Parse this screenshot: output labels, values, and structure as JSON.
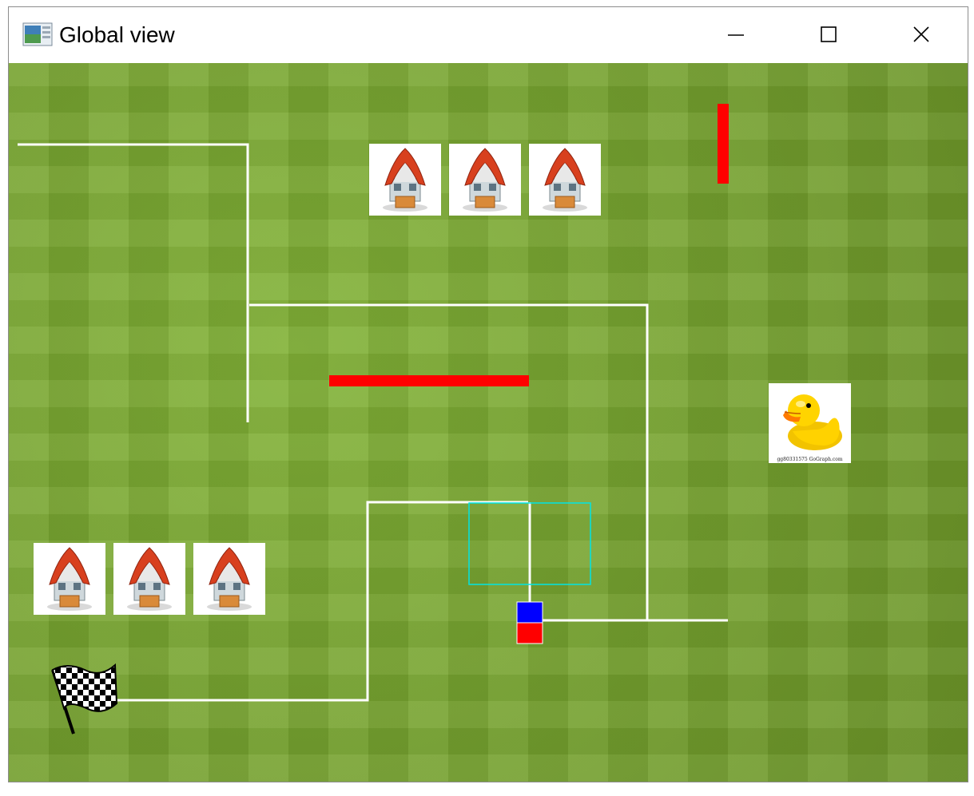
{
  "window": {
    "title": "Global view",
    "controls": {
      "minimize": "minimize-icon",
      "maximize": "maximize-icon",
      "close": "close-icon"
    }
  },
  "field": {
    "background": "grass",
    "colors": {
      "wall": "#ff0000",
      "path": "#ffffff",
      "target_box": "#00e5e5",
      "robot_top": "#0000ff",
      "robot_bottom": "#ff0000"
    }
  },
  "sprites": {
    "houses_top": [
      "house-icon",
      "house-icon",
      "house-icon"
    ],
    "houses_left": [
      "house-icon",
      "house-icon",
      "house-icon"
    ],
    "duck": {
      "icon": "rubber-duck-icon",
      "caption": "gg80331575 GoGraph.com"
    },
    "flag": "checkered-flag-icon"
  }
}
